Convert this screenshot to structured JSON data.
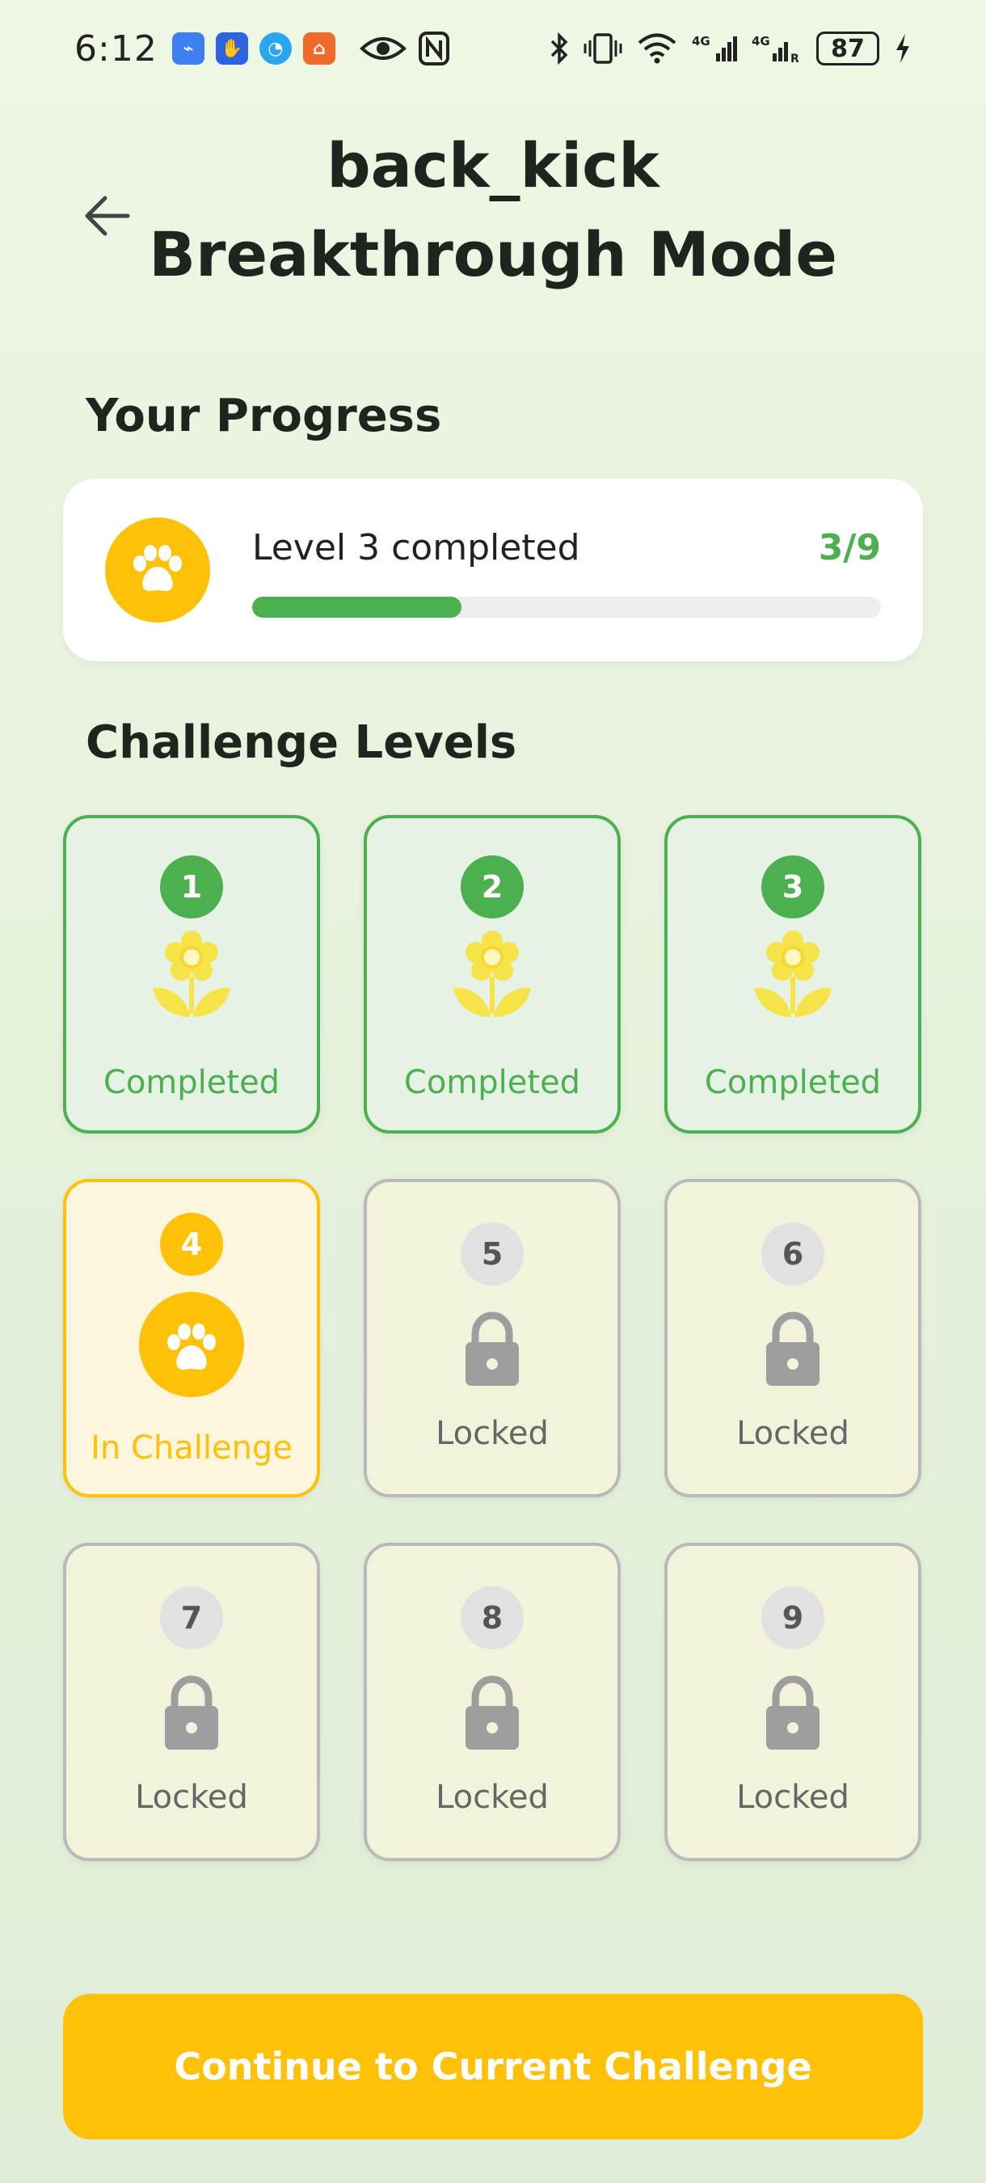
{
  "status_bar": {
    "time": "6:12",
    "battery": "87",
    "icons": [
      "usb-icon",
      "app-icon",
      "browser-icon",
      "shop-icon",
      "eye-icon",
      "nfc-icon",
      "bluetooth-icon",
      "vibrate-icon",
      "wifi-icon",
      "signal-4g-icon",
      "signal-4g-r-icon",
      "charging-icon"
    ]
  },
  "header": {
    "back_icon": "arrow-left-icon",
    "title_line1": "back_kick",
    "title_line2": "Breakthrough Mode"
  },
  "progress": {
    "section_title": "Your Progress",
    "label": "Level 3 completed",
    "count": "3/9",
    "fraction": 0.333,
    "icon": "paw-icon"
  },
  "levels": {
    "section_title": "Challenge Levels",
    "items": [
      {
        "number": "1",
        "status": "Completed",
        "state": "completed",
        "icon": "flower-icon"
      },
      {
        "number": "2",
        "status": "Completed",
        "state": "completed",
        "icon": "flower-icon"
      },
      {
        "number": "3",
        "status": "Completed",
        "state": "completed",
        "icon": "flower-icon"
      },
      {
        "number": "4",
        "status": "In Challenge",
        "state": "current",
        "icon": "paw-icon"
      },
      {
        "number": "5",
        "status": "Locked",
        "state": "locked",
        "icon": "lock-icon"
      },
      {
        "number": "6",
        "status": "Locked",
        "state": "locked",
        "icon": "lock-icon"
      },
      {
        "number": "7",
        "status": "Locked",
        "state": "locked",
        "icon": "lock-icon"
      },
      {
        "number": "8",
        "status": "Locked",
        "state": "locked",
        "icon": "lock-icon"
      },
      {
        "number": "9",
        "status": "Locked",
        "state": "locked",
        "icon": "lock-icon"
      }
    ]
  },
  "cta": {
    "label": "Continue to Current Challenge"
  },
  "colors": {
    "accent_green": "#4caf50",
    "accent_yellow": "#ffc107",
    "locked_gray": "#9e9e9e"
  }
}
